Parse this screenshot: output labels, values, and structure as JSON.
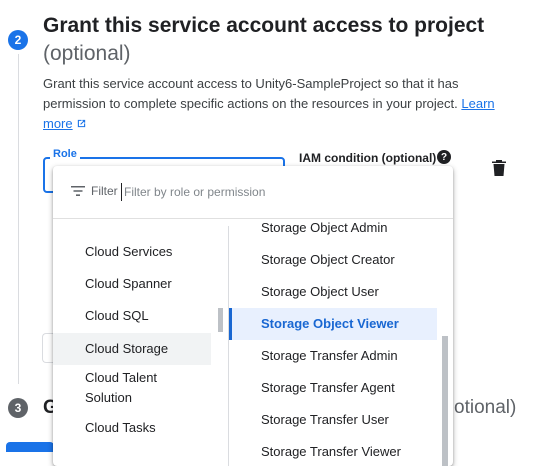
{
  "step2": {
    "number": "2",
    "title": "Grant this service account access to project",
    "optional": "(optional)",
    "description_prefix": "Grant this service account access to Unity6-SampleProject so that it has permission to complete specific actions on the resources in your project.",
    "learn_more": "Learn more"
  },
  "role_field": {
    "label": "Role"
  },
  "iam": {
    "label": "IAM condition (optional)",
    "help": "?"
  },
  "filter": {
    "label": "Filter",
    "placeholder": "Filter by role or permission"
  },
  "left_list": [
    {
      "label": "Cloud Services"
    },
    {
      "label": "Cloud Spanner"
    },
    {
      "label": "Cloud SQL"
    },
    {
      "label": "Cloud Storage",
      "selected": true
    },
    {
      "label": "Cloud Talent Solution"
    },
    {
      "label": "Cloud Tasks"
    }
  ],
  "right_list": [
    {
      "label": "Storage Object Admin"
    },
    {
      "label": "Storage Object Creator"
    },
    {
      "label": "Storage Object User"
    },
    {
      "label": "Storage Object Viewer",
      "selected": true
    },
    {
      "label": "Storage Transfer Admin"
    },
    {
      "label": "Storage Transfer Agent"
    },
    {
      "label": "Storage Transfer User"
    },
    {
      "label": "Storage Transfer Viewer"
    }
  ],
  "step3": {
    "number": "3",
    "title_start": "G",
    "optional": "otional)"
  },
  "colors": {
    "accent": "#1a73e8",
    "badge_active": "#1a73e8",
    "badge_inactive": "#5f6368"
  },
  "icons": {
    "delete": "trash-icon",
    "filter": "filter-icon",
    "external": "external-link-icon"
  }
}
